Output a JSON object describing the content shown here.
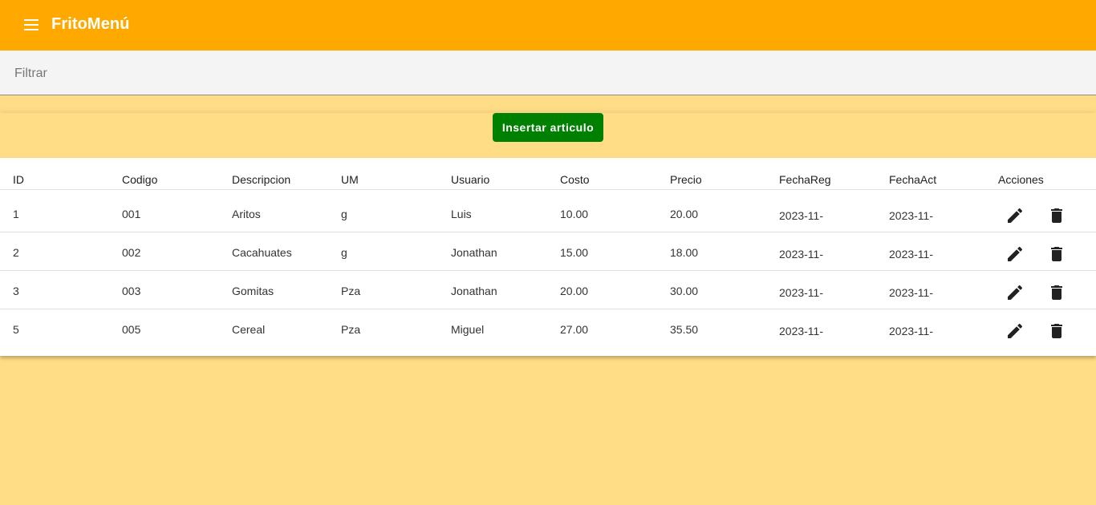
{
  "app": {
    "title": "FritoMenú",
    "menu_icon": "hamburger-menu-icon"
  },
  "filter": {
    "placeholder": "Filtrar",
    "value": ""
  },
  "actions": {
    "insert_label": "Insertar articulo"
  },
  "colors": {
    "toolbar": "#ffa800",
    "background": "#ffdd87",
    "insert_button": "#008000"
  },
  "table": {
    "headers": [
      "ID",
      "Codigo",
      "Descripcion",
      "UM",
      "Usuario",
      "Costo",
      "Precio",
      "FechaReg",
      "FechaAct",
      "Acciones"
    ],
    "rows": [
      {
        "id": "1",
        "codigo": "001",
        "descripcion": "Aritos",
        "um": "g",
        "usuario": "Luis",
        "costo": "10.00",
        "precio": "20.00",
        "fechareg": "2023-11-",
        "fechaact": "2023-11-"
      },
      {
        "id": "2",
        "codigo": "002",
        "descripcion": "Cacahuates",
        "um": "g",
        "usuario": "Jonathan",
        "costo": "15.00",
        "precio": "18.00",
        "fechareg": "2023-11-",
        "fechaact": "2023-11-"
      },
      {
        "id": "3",
        "codigo": "003",
        "descripcion": "Gomitas",
        "um": "Pza",
        "usuario": "Jonathan",
        "costo": "20.00",
        "precio": "30.00",
        "fechareg": "2023-11-",
        "fechaact": "2023-11-"
      },
      {
        "id": "5",
        "codigo": "005",
        "descripcion": "Cereal",
        "um": "Pza",
        "usuario": "Miguel",
        "costo": "27.00",
        "precio": "35.50",
        "fechareg": "2023-11-",
        "fechaact": "2023-11-"
      }
    ],
    "row_actions": {
      "edit_icon": "pencil-edit-icon",
      "delete_icon": "trash-delete-icon"
    }
  }
}
